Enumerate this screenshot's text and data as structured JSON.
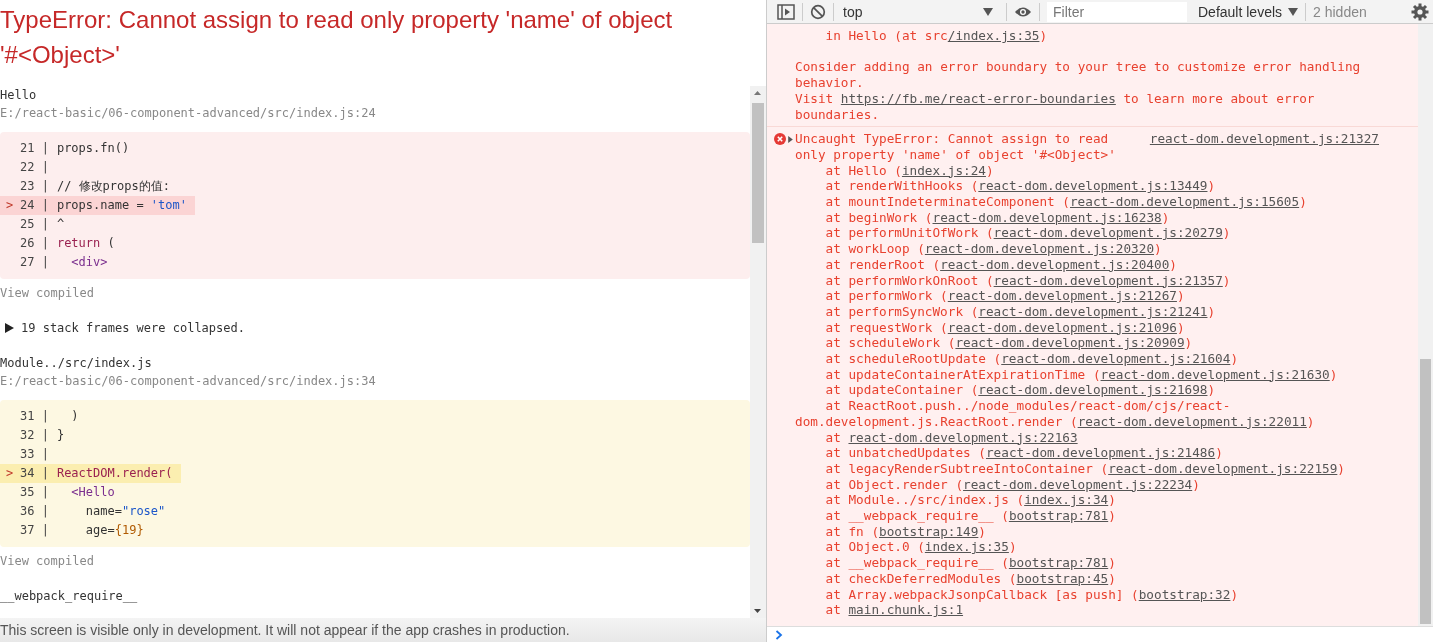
{
  "overlay": {
    "title": "TypeError: Cannot assign to read only property 'name' of object '#<Object>'",
    "items": [
      {
        "kind": "frame",
        "name": "Hello",
        "path": "E:/react-basic/06-component-advanced/src/index.js:24",
        "color": "#fdeeee",
        "lines": [
          {
            "gutter": "21 |",
            "highlighted": false,
            "tokens": [
              {
                "t": "props.fn()",
                "kind": "plain"
              }
            ]
          },
          {
            "gutter": "22 |",
            "highlighted": false
          },
          {
            "gutter": "23 |",
            "highlighted": false,
            "tokens": [
              {
                "t": "// 修改props的值:",
                "kind": "plain"
              }
            ]
          },
          {
            "marker": ">",
            "gutter": "24 |",
            "highlighted": true,
            "tokens": [
              {
                "t": "props.name = ",
                "kind": "plain"
              },
              {
                "t": "'tom'",
                "kind": "string"
              }
            ]
          },
          {
            "gutter": "25 |",
            "highlighted": false,
            "tokens": [
              {
                "t": "^",
                "kind": "plain"
              }
            ]
          },
          {
            "gutter": "26 |",
            "highlighted": false,
            "tokens": [
              {
                "t": "return",
                "kind": "keyword"
              },
              {
                "t": " (",
                "kind": "plain"
              }
            ]
          },
          {
            "gutter": "27 |",
            "highlighted": false,
            "tokens": [
              {
                "t": "  <div>",
                "kind": "tag"
              }
            ]
          }
        ],
        "link": "View compiled"
      },
      {
        "kind": "collapsed",
        "expanded": false,
        "text": "19 stack frames were collapsed."
      },
      {
        "kind": "frame",
        "name": "Module../src/index.js",
        "path": "E:/react-basic/06-component-advanced/src/index.js:34",
        "color": "#fdf8e2",
        "lines": [
          {
            "gutter": "31 |",
            "highlighted": false,
            "tokens": [
              {
                "t": "  )",
                "kind": "plain"
              }
            ]
          },
          {
            "gutter": "32 |",
            "highlighted": false,
            "tokens": [
              {
                "t": "}",
                "kind": "plain"
              }
            ]
          },
          {
            "gutter": "33 |",
            "highlighted": false
          },
          {
            "marker": ">",
            "gutter": "34 |",
            "highlighted": true,
            "tokens": [
              {
                "t": "ReactDOM.render(",
                "kind": "keyword"
              }
            ]
          },
          {
            "gutter": "35 |",
            "highlighted": false,
            "tokens": [
              {
                "t": "  <Hello",
                "kind": "tag"
              }
            ]
          },
          {
            "gutter": "36 |",
            "highlighted": false,
            "tokens": [
              {
                "t": "    name=",
                "kind": "plain"
              },
              {
                "t": "\"rose\"",
                "kind": "string"
              }
            ]
          },
          {
            "gutter": "37 |",
            "highlighted": false,
            "tokens": [
              {
                "t": "    age=",
                "kind": "plain"
              },
              {
                "t": "{19}",
                "kind": "number"
              }
            ]
          }
        ],
        "link": "View compiled"
      },
      {
        "kind": "frame",
        "name": "__webpack_require__"
      }
    ],
    "footer": "This screen is visible only in development. It will not appear if the app crashes in production."
  },
  "console": {
    "toolbar": {
      "context": "top",
      "filter_placeholder": "Filter",
      "levels": "Default levels",
      "hidden": "2 hidden"
    },
    "messages": [
      {
        "kind": "continuation",
        "frames": [
          {
            "prefix": "in Hello (at src",
            "link": "/index.js:35",
            "suffix": ")"
          }
        ],
        "notes": [
          {
            "before": "Consider adding an error boundary to your tree to customize error handling behavior."
          },
          {
            "before": "Visit ",
            "link": "https://fb.me/react-error-boundaries",
            "after": " to learn more about error boundaries."
          }
        ]
      },
      {
        "kind": "error",
        "expanded": false,
        "text": "Uncaught TypeError: Cannot assign to read only property 'name' of object '#<Object>'",
        "source": "react-dom.development.js:21327",
        "frames": [
          {
            "prefix": "at Hello (",
            "link": "index.js:24",
            "suffix": ")"
          },
          {
            "prefix": "at renderWithHooks (",
            "link": "react-dom.development.js:13449",
            "suffix": ")"
          },
          {
            "prefix": "at mountIndeterminateComponent (",
            "link": "react-dom.development.js:15605",
            "suffix": ")"
          },
          {
            "prefix": "at beginWork (",
            "link": "react-dom.development.js:16238",
            "suffix": ")"
          },
          {
            "prefix": "at performUnitOfWork (",
            "link": "react-dom.development.js:20279",
            "suffix": ")"
          },
          {
            "prefix": "at workLoop (",
            "link": "react-dom.development.js:20320",
            "suffix": ")"
          },
          {
            "prefix": "at renderRoot (",
            "link": "react-dom.development.js:20400",
            "suffix": ")"
          },
          {
            "prefix": "at performWorkOnRoot (",
            "link": "react-dom.development.js:21357",
            "suffix": ")"
          },
          {
            "prefix": "at performWork (",
            "link": "react-dom.development.js:21267",
            "suffix": ")"
          },
          {
            "prefix": "at performSyncWork (",
            "link": "react-dom.development.js:21241",
            "suffix": ")"
          },
          {
            "prefix": "at requestWork (",
            "link": "react-dom.development.js:21096",
            "suffix": ")"
          },
          {
            "prefix": "at scheduleWork (",
            "link": "react-dom.development.js:20909",
            "suffix": ")"
          },
          {
            "prefix": "at scheduleRootUpdate (",
            "link": "react-dom.development.js:21604",
            "suffix": ")"
          },
          {
            "prefix": "at updateContainerAtExpirationTime (",
            "link": "react-dom.development.js:21630",
            "suffix": ")"
          },
          {
            "prefix": "at updateContainer (",
            "link": "react-dom.development.js:21698",
            "suffix": ")"
          },
          {
            "prefix": "at ReactRoot.push../node_modules/react-dom/cjs/react-dom.development.js.ReactRoot.render (",
            "link": "react-dom.development.js:22011",
            "suffix": ")"
          },
          {
            "prefix": "at ",
            "link": "react-dom.development.js:22163"
          },
          {
            "prefix": "at unbatchedUpdates (",
            "link": "react-dom.development.js:21486",
            "suffix": ")"
          },
          {
            "prefix": "at legacyRenderSubtreeIntoContainer (",
            "link": "react-dom.development.js:22159",
            "suffix": ")"
          },
          {
            "prefix": "at Object.render (",
            "link": "react-dom.development.js:22234",
            "suffix": ")"
          },
          {
            "prefix": "at Module../src/index.js (",
            "link": "index.js:34",
            "suffix": ")"
          },
          {
            "prefix": "at __webpack_require__ (",
            "link": "bootstrap:781",
            "suffix": ")"
          },
          {
            "prefix": "at fn (",
            "link": "bootstrap:149",
            "suffix": ")"
          },
          {
            "prefix": "at Object.0 (",
            "link": "index.js:35",
            "suffix": ")"
          },
          {
            "prefix": "at __webpack_require__ (",
            "link": "bootstrap:781",
            "suffix": ")"
          },
          {
            "prefix": "at checkDeferredModules (",
            "link": "bootstrap:45",
            "suffix": ")"
          },
          {
            "prefix": "at Array.webpackJsonpCallback [as push] (",
            "link": "bootstrap:32",
            "suffix": ")"
          },
          {
            "prefix": "at ",
            "link": "main.chunk.js:1"
          }
        ]
      }
    ]
  }
}
